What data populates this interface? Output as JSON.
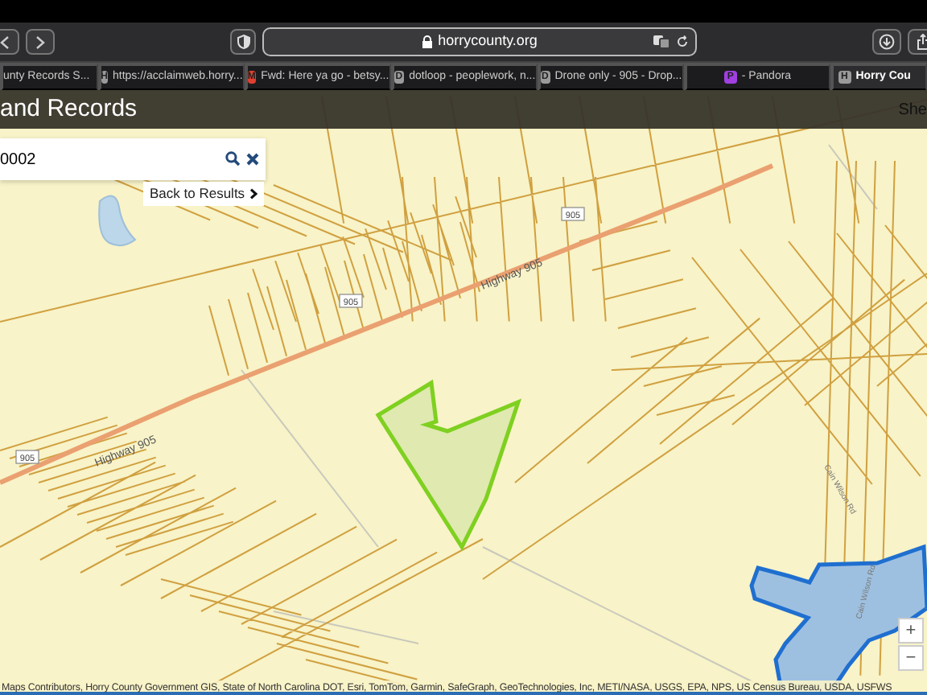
{
  "browser": {
    "url": "horrycounty.org",
    "tabs": [
      {
        "label": "unty Records S...",
        "selected": false
      },
      {
        "label": "https://acclaimweb.horry...",
        "favicon": "H",
        "color": "#9a9a9a",
        "selected": false
      },
      {
        "label": "Fwd: Here ya go - betsy...",
        "favicon": "M",
        "color": "#e04030",
        "selected": false
      },
      {
        "label": "dotloop - peoplework, n...",
        "favicon": "D",
        "color": "#9a9a9a",
        "selected": false
      },
      {
        "label": "Drone only - 905 - Drop...",
        "favicon": "D",
        "color": "#9a9a9a",
        "selected": false
      },
      {
        "label": "- Pandora",
        "favicon": "P",
        "color": "#a040e0",
        "selected": false
      },
      {
        "label": "Horry Cou",
        "favicon": "H",
        "color": "#9a9a9a",
        "selected": true
      }
    ]
  },
  "header": {
    "title": "and Records",
    "right_text": "She"
  },
  "search": {
    "value": "0002"
  },
  "back_link": "Back to Results",
  "map": {
    "labels": [
      {
        "kind": "highway",
        "text": "Highway 905"
      },
      {
        "kind": "highway",
        "text": "Highway 905"
      },
      {
        "kind": "shield",
        "text": "905"
      },
      {
        "kind": "shield",
        "text": "905"
      },
      {
        "kind": "shield",
        "text": "905"
      },
      {
        "kind": "road",
        "text": "Cain Wilson Rd"
      },
      {
        "kind": "road",
        "text": "Cain Wilson Rd"
      }
    ],
    "zoom_buttons": [
      "+",
      "−"
    ],
    "attribution": "Maps Contributors, Horry County Government GIS, State of North Carolina DOT, Esri, TomTom, Garmin, SafeGraph, GeoTechnologies, Inc, METI/NASA, USGS, EPA, NPS, US Census Bureau, USDA, USFWS"
  }
}
